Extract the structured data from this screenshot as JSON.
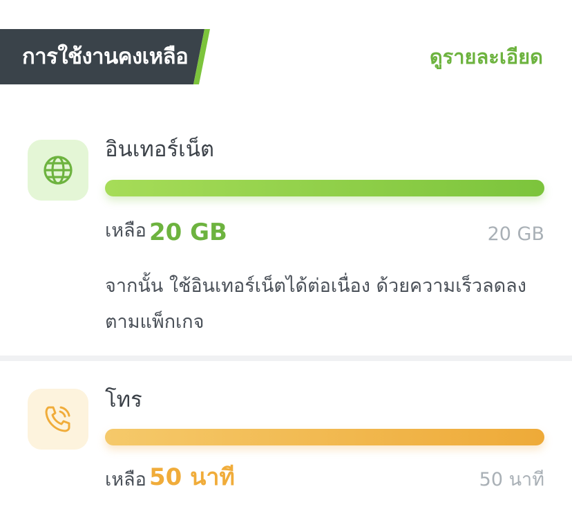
{
  "header": {
    "title": "การใช้งานคงเหลือ",
    "detail_link": "ดูรายละเอียด"
  },
  "colors": {
    "header_bg": "#3a434a",
    "accent_green": "#6db33f",
    "accent_orange": "#f0ac3a"
  },
  "internet": {
    "icon": "globe-icon",
    "title": "อินเทอร์เน็ต",
    "remaining_label": "เหลือ",
    "remaining_value": "20 GB",
    "total_value": "20 GB",
    "remaining_fraction": 1.0,
    "note": "จากนั้น ใช้อินเทอร์เน็ตได้ต่อเนื่อง ด้วยความเร็วลดลงตามแพ็กเกจ"
  },
  "call": {
    "icon": "phone-call-icon",
    "title": "โทร",
    "remaining_label": "เหลือ",
    "remaining_value": "50 นาที",
    "total_value": "50 นาที",
    "remaining_fraction": 1.0
  }
}
